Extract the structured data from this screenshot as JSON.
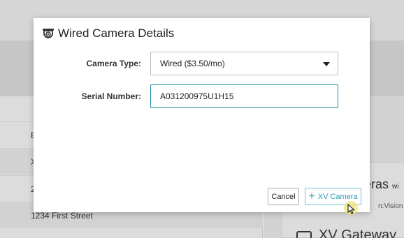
{
  "background": {
    "rows": [
      "B",
      "X",
      "2",
      "1234 First Street"
    ],
    "card_title": "eras",
    "card_title_suffix": "wi",
    "card_sub": "n:Vision is c",
    "card_bottom": "XV Gateway"
  },
  "modal": {
    "title": "Wired Camera Details",
    "camera_type_label": "Camera Type:",
    "camera_type_value": "Wired ($3.50/mo)",
    "serial_label": "Serial Number:",
    "serial_value": "A031200975U1H15",
    "cancel_label": "Cancel",
    "add_label": "XV Camera"
  },
  "colors": {
    "accent": "#2a9cb4",
    "focus_border": "#1b8fa6"
  },
  "icons": {
    "title_icon": "dome-camera-icon",
    "caret": "caret-down-icon",
    "add": "plus-icon",
    "cursor": "mouse-pointer-icon"
  }
}
